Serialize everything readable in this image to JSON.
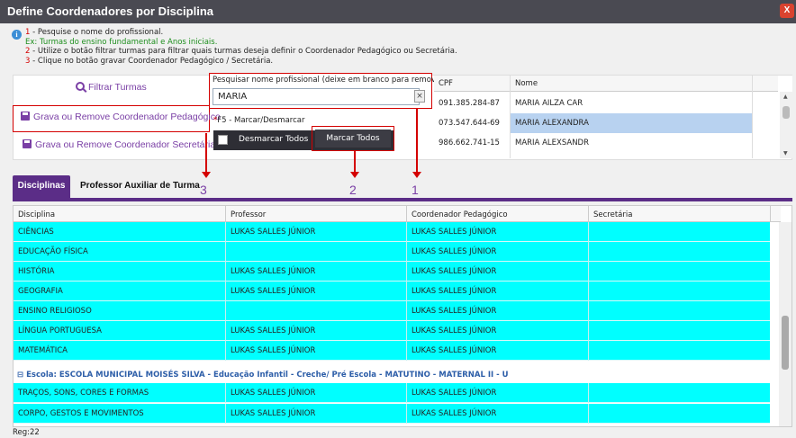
{
  "window": {
    "title": "Define Coordenadores por Disciplina",
    "close_label": "X"
  },
  "instructions": {
    "info_icon": "i",
    "line1_num": "1",
    "line1_text": " - Pesquise o nome do profissional.",
    "line1b_text": "Ex: Turmas do ensino fundamental e Anos iniciais.",
    "line2_num": "2",
    "line2_text": " - Utilize o botão filtrar turmas para filtrar quais turmas deseja definir o Coordenador Pedagógico ou Secretária.",
    "line3_num": "3",
    "line3_text": " - Clique no botão gravar Coordenador Pedagógico / Secretária."
  },
  "actions": {
    "filter_label": "Filtrar Turmas",
    "grava_pedagogico_label": "Grava ou Remove Coordenador Pedagógico",
    "grava_secretaria_label": "Grava ou Remove Coordenador Secretária"
  },
  "search": {
    "label": "Pesquisar nome profissional (deixe em branco para remover)",
    "value": "MARIA",
    "clear": "×"
  },
  "marking": {
    "f5_star": "*",
    "f5_label": "F5 - Marcar/Desmarcar",
    "desmarcar_label": "Desmarcar Todos",
    "marcar_label": "Marcar Todos"
  },
  "professionals": {
    "columns": [
      "CPF",
      "Nome"
    ],
    "rows": [
      {
        "cpf": "091.385.284-87",
        "nome": "MARIA AILZA CAR"
      },
      {
        "cpf": "073.547.644-69",
        "nome": "MARIA ALEXANDRA"
      },
      {
        "cpf": "986.662.741-15",
        "nome": "MARIA ALEXSANDR"
      }
    ],
    "selected_index": 1
  },
  "annotations": {
    "a1": "1",
    "a2": "2",
    "a3": "3"
  },
  "tabs": {
    "active": "Disciplinas",
    "inactive": "Professor Auxiliar de Turma"
  },
  "grid": {
    "columns": [
      "Disciplina",
      "Professor",
      "Coordenador Pedagógico",
      "Secretária"
    ],
    "rows": [
      {
        "disciplina": "CIÊNCIAS",
        "professor": "LUKAS SALLES JÚNIOR",
        "coordenador": "LUKAS SALLES JÚNIOR",
        "secretaria": ""
      },
      {
        "disciplina": "EDUCAÇÃO FÍSICA",
        "professor": "",
        "coordenador": "LUKAS SALLES JÚNIOR",
        "secretaria": ""
      },
      {
        "disciplina": "HISTÓRIA",
        "professor": "LUKAS SALLES JÚNIOR",
        "coordenador": "LUKAS SALLES JÚNIOR",
        "secretaria": ""
      },
      {
        "disciplina": "GEOGRAFIA",
        "professor": "LUKAS SALLES JÚNIOR",
        "coordenador": "LUKAS SALLES JÚNIOR",
        "secretaria": ""
      },
      {
        "disciplina": "ENSINO RELIGIOSO",
        "professor": "",
        "coordenador": "LUKAS SALLES JÚNIOR",
        "secretaria": ""
      },
      {
        "disciplina": "LÍNGUA PORTUGUESA",
        "professor": "LUKAS SALLES JÚNIOR",
        "coordenador": "LUKAS SALLES JÚNIOR",
        "secretaria": ""
      },
      {
        "disciplina": "MATEMÁTICA",
        "professor": "LUKAS SALLES JÚNIOR",
        "coordenador": "LUKAS SALLES JÚNIOR",
        "secretaria": ""
      }
    ],
    "group_label": "⊟ Escola: ESCOLA MUNICIPAL MOISÉS SILVA - Educação Infantil - Creche/ Pré Escola - MATUTINO - MATERNAL II - U",
    "group_rows": [
      {
        "disciplina": "TRAÇOS, SONS, CORES E FORMAS",
        "professor": "LUKAS SALLES JÚNIOR",
        "coordenador": "LUKAS SALLES JÚNIOR",
        "secretaria": ""
      },
      {
        "disciplina": "CORPO, GESTOS E MOVIMENTOS",
        "professor": "LUKAS SALLES JÚNIOR",
        "coordenador": "LUKAS SALLES JÚNIOR",
        "secretaria": ""
      }
    ]
  },
  "footer": {
    "reg": "Reg:22"
  },
  "colors": {
    "accent": "#5b2d87",
    "row_highlight": "#00ffff",
    "annotation_red": "#d40000",
    "link_purple": "#7a3fa5"
  }
}
